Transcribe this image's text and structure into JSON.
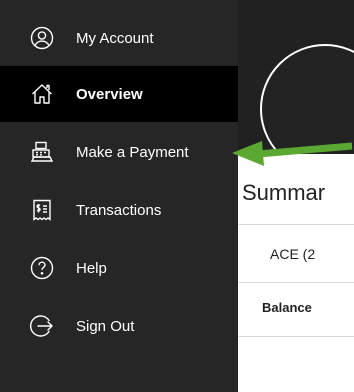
{
  "sidebar": {
    "items": [
      {
        "label": "My Account",
        "icon": "user-circle-icon",
        "active": false
      },
      {
        "label": "Overview",
        "icon": "home-icon",
        "active": true
      },
      {
        "label": "Make a Payment",
        "icon": "cash-register-icon",
        "active": false
      },
      {
        "label": "Transactions",
        "icon": "receipt-icon",
        "active": false
      },
      {
        "label": "Help",
        "icon": "help-icon",
        "active": false
      },
      {
        "label": "Sign Out",
        "icon": "sign-out-icon",
        "active": false
      }
    ]
  },
  "main": {
    "summary_heading": "Summar",
    "summary_row": "ACE (2",
    "balance_label": "Balance"
  },
  "colors": {
    "sidebar_bg": "#262626",
    "active_bg": "#000000",
    "arrow": "#5aa832"
  }
}
